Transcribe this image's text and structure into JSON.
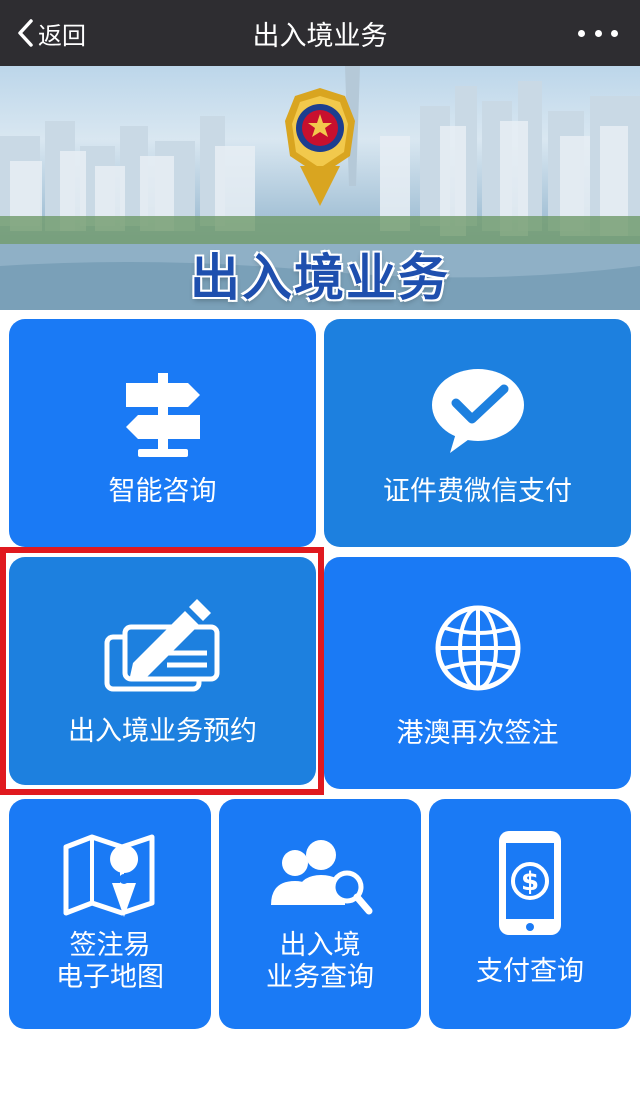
{
  "navbar": {
    "back_label": "返回",
    "title": "出入境业务"
  },
  "banner": {
    "title": "出入境业务"
  },
  "tiles": [
    {
      "label": "智能咨询",
      "icon": "signpost-icon"
    },
    {
      "label": "证件费微信支付",
      "icon": "wechat-pay-icon"
    },
    {
      "label": "出入境业务预约",
      "icon": "pen-card-icon"
    },
    {
      "label": "港澳再次签注",
      "icon": "globe-icon"
    },
    {
      "label_line1": "签注易",
      "label_line2": "电子地图",
      "icon": "map-pin-icon"
    },
    {
      "label_line1": "出入境",
      "label_line2": "业务查询",
      "icon": "people-search-icon"
    },
    {
      "label": "支付查询",
      "icon": "phone-dollar-icon"
    }
  ],
  "colors": {
    "navbar": "#2e2d31",
    "tile_bright": "#1a7af5",
    "tile_medium": "#1d80df",
    "highlight": "#e0191f"
  }
}
